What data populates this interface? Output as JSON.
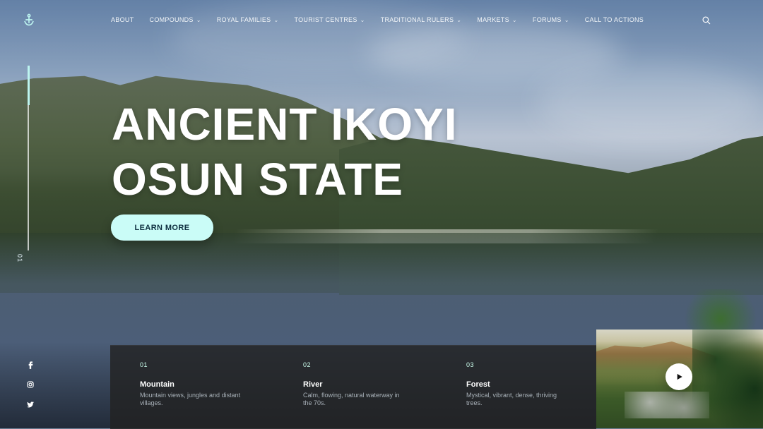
{
  "topbar": {
    "logo_icon": "anchor-icon",
    "nav": [
      {
        "label": "ABOUT",
        "has_dropdown": false
      },
      {
        "label": "COMPOUNDS",
        "has_dropdown": true
      },
      {
        "label": "ROYAL FAMILIES",
        "has_dropdown": true
      },
      {
        "label": "TOURIST CENTRES",
        "has_dropdown": true
      },
      {
        "label": "TRADITIONAL RULERS",
        "has_dropdown": true
      },
      {
        "label": "MARKETS",
        "has_dropdown": true
      },
      {
        "label": "FORUMS",
        "has_dropdown": true
      },
      {
        "label": "CALL TO ACTIONS",
        "has_dropdown": false
      }
    ],
    "search_icon": "search-icon"
  },
  "hero": {
    "headline_line1": "ANCIENT IKOYI",
    "headline_line2": "OSUN STATE",
    "cta_label": "LEARN MORE",
    "slide_number": "01"
  },
  "social": [
    {
      "icon": "facebook-icon"
    },
    {
      "icon": "instagram-icon"
    },
    {
      "icon": "twitter-icon"
    }
  ],
  "info": [
    {
      "num": "01",
      "title": "Mountain",
      "desc": "Mountain views, jungles and distant villages."
    },
    {
      "num": "02",
      "title": "River",
      "desc": "Calm, flowing, natural waterway in the 70s."
    },
    {
      "num": "03",
      "title": "Forest",
      "desc": "Mystical, vibrant, dense, thriving trees."
    }
  ],
  "video": {
    "play_icon": "play-icon"
  },
  "colors": {
    "accent": "#cafcf7",
    "progress": "#bdf5f0",
    "panel": "#222222"
  }
}
